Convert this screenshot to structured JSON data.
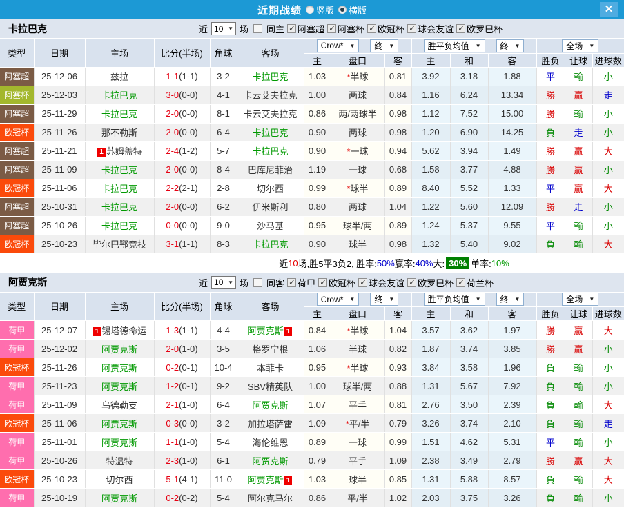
{
  "titlebar": {
    "title": "近期战绩",
    "radio_vertical": "竖版",
    "radio_horizontal": "横版",
    "radio_selected": "横版",
    "close": "✕"
  },
  "columns": {
    "type": "类型",
    "date": "日期",
    "home": "主场",
    "score": "比分(半场)",
    "corner": "角球",
    "away": "客场",
    "odds_home": "主",
    "odds_handicap": "盘口",
    "odds_away": "客",
    "avg_home": "主",
    "avg_draw": "和",
    "avg_away": "客",
    "result": "胜负",
    "handicap_result": "让球",
    "goals": "进球数"
  },
  "dropdowns": {
    "crow": "Crow*",
    "final": "终",
    "avg": "胜平负均值",
    "full": "全场"
  },
  "league_colors": {
    "阿塞超": "#7B5B45",
    "阿塞杯": "#A3B72D",
    "欧冠杯": "#FB4A0B",
    "荷甲": "#FF6EAE"
  },
  "outcome_colors": {
    "勝": "r",
    "平": "b",
    "負": "g",
    "贏": "r",
    "輸": "g",
    "走": "b",
    "大": "r",
    "小": "g"
  },
  "sections": [
    {
      "team": "卡拉巴克",
      "filter": {
        "near_label": "近",
        "games_value": "10",
        "games_label": "场",
        "same_label": "同主",
        "same_checked": false,
        "leagues": [
          "阿塞超",
          "阿塞杯",
          "欧冠杯",
          "球会友谊",
          "欧罗巴杯"
        ]
      },
      "rows": [
        {
          "lg": "阿塞超",
          "date": "25-12-06",
          "home": "兹拉",
          "hb": "",
          "hg": false,
          "ft": "1-1",
          "ht": "(1-1)",
          "cn": "3-2",
          "away": "卡拉巴克",
          "ab": "",
          "ag": true,
          "o1": "1.03",
          "star": true,
          "pk": "半球",
          "o2": "0.81",
          "m1": "3.92",
          "m2": "3.18",
          "m3": "1.88",
          "rs": "平",
          "hc": "輸",
          "gl": "小"
        },
        {
          "lg": "阿塞杯",
          "date": "25-12-03",
          "home": "卡拉巴克",
          "hb": "",
          "hg": true,
          "ft": "3-0",
          "ht": "(0-0)",
          "cn": "4-1",
          "away": "卡云艾夫拉克",
          "ab": "",
          "ag": false,
          "o1": "1.00",
          "star": false,
          "pk": "两球",
          "o2": "0.84",
          "m1": "1.16",
          "m2": "6.24",
          "m3": "13.34",
          "rs": "勝",
          "hc": "贏",
          "gl": "走"
        },
        {
          "lg": "阿塞超",
          "date": "25-11-29",
          "home": "卡拉巴克",
          "hb": "",
          "hg": true,
          "ft": "2-0",
          "ht": "(0-0)",
          "cn": "8-1",
          "away": "卡云艾夫拉克",
          "ab": "",
          "ag": false,
          "o1": "0.86",
          "star": false,
          "pk": "两/两球半",
          "o2": "0.98",
          "m1": "1.12",
          "m2": "7.52",
          "m3": "15.00",
          "rs": "勝",
          "hc": "輸",
          "gl": "小"
        },
        {
          "lg": "欧冠杯",
          "date": "25-11-26",
          "home": "那不勒斯",
          "hb": "",
          "hg": false,
          "ft": "2-0",
          "ht": "(0-0)",
          "cn": "6-4",
          "away": "卡拉巴克",
          "ab": "",
          "ag": true,
          "o1": "0.90",
          "star": false,
          "pk": "两球",
          "o2": "0.98",
          "m1": "1.20",
          "m2": "6.90",
          "m3": "14.25",
          "rs": "負",
          "hc": "走",
          "gl": "小"
        },
        {
          "lg": "阿塞超",
          "date": "25-11-21",
          "home": "苏姆盖特",
          "hb": "1",
          "hg": false,
          "ft": "2-4",
          "ht": "(1-2)",
          "cn": "5-7",
          "away": "卡拉巴克",
          "ab": "",
          "ag": true,
          "o1": "0.90",
          "star": true,
          "pk": "一球",
          "o2": "0.94",
          "m1": "5.62",
          "m2": "3.94",
          "m3": "1.49",
          "rs": "勝",
          "hc": "贏",
          "gl": "大"
        },
        {
          "lg": "阿塞超",
          "date": "25-11-09",
          "home": "卡拉巴克",
          "hb": "",
          "hg": true,
          "ft": "2-0",
          "ht": "(0-0)",
          "cn": "8-4",
          "away": "巴库尼菲治",
          "ab": "",
          "ag": false,
          "o1": "1.19",
          "star": false,
          "pk": "一球",
          "o2": "0.68",
          "m1": "1.58",
          "m2": "3.77",
          "m3": "4.88",
          "rs": "勝",
          "hc": "贏",
          "gl": "小"
        },
        {
          "lg": "欧冠杯",
          "date": "25-11-06",
          "home": "卡拉巴克",
          "hb": "",
          "hg": true,
          "ft": "2-2",
          "ht": "(2-1)",
          "cn": "2-8",
          "away": "切尔西",
          "ab": "",
          "ag": false,
          "o1": "0.99",
          "star": true,
          "pk": "球半",
          "o2": "0.89",
          "m1": "8.40",
          "m2": "5.52",
          "m3": "1.33",
          "rs": "平",
          "hc": "贏",
          "gl": "大"
        },
        {
          "lg": "阿塞超",
          "date": "25-10-31",
          "home": "卡拉巴克",
          "hb": "",
          "hg": true,
          "ft": "2-0",
          "ht": "(0-0)",
          "cn": "6-2",
          "away": "伊米斯利",
          "ab": "",
          "ag": false,
          "o1": "0.80",
          "star": false,
          "pk": "两球",
          "o2": "1.04",
          "m1": "1.22",
          "m2": "5.60",
          "m3": "12.09",
          "rs": "勝",
          "hc": "走",
          "gl": "小"
        },
        {
          "lg": "阿塞超",
          "date": "25-10-26",
          "home": "卡拉巴克",
          "hb": "",
          "hg": true,
          "ft": "0-0",
          "ht": "(0-0)",
          "cn": "9-0",
          "away": "沙马基",
          "ab": "",
          "ag": false,
          "o1": "0.95",
          "star": false,
          "pk": "球半/两",
          "o2": "0.89",
          "m1": "1.24",
          "m2": "5.37",
          "m3": "9.55",
          "rs": "平",
          "hc": "輸",
          "gl": "小"
        },
        {
          "lg": "欧冠杯",
          "date": "25-10-23",
          "home": "毕尔巴鄂竞技",
          "hb": "",
          "hg": false,
          "ft": "3-1",
          "ht": "(1-1)",
          "cn": "8-3",
          "away": "卡拉巴克",
          "ab": "",
          "ag": true,
          "o1": "0.90",
          "star": false,
          "pk": "球半",
          "o2": "0.98",
          "m1": "1.32",
          "m2": "5.40",
          "m3": "9.02",
          "rs": "負",
          "hc": "輸",
          "gl": "大"
        }
      ],
      "summary": [
        {
          "t": "近",
          "c": "k"
        },
        {
          "t": "10",
          "c": "r"
        },
        {
          "t": "场,胜5平3负2, 胜率:",
          "c": "k"
        },
        {
          "t": "50%",
          "c": "b"
        },
        {
          "t": " 赢率:",
          "c": "k"
        },
        {
          "t": "40%",
          "c": "b"
        },
        {
          "t": " 大: ",
          "c": "k"
        },
        {
          "t": "30%",
          "c": "wg"
        },
        {
          "t": " 单率:",
          "c": "k"
        },
        {
          "t": "10%",
          "c": "g"
        }
      ]
    },
    {
      "team": "阿贾克斯",
      "filter": {
        "near_label": "近",
        "games_value": "10",
        "games_label": "场",
        "same_label": "同客",
        "same_checked": false,
        "leagues": [
          "荷甲",
          "欧冠杯",
          "球会友谊",
          "欧罗巴杯",
          "荷兰杯"
        ]
      },
      "rows": [
        {
          "lg": "荷甲",
          "date": "25-12-07",
          "home": "锡塔德命运",
          "hb": "1",
          "hg": false,
          "ft": "1-3",
          "ht": "(1-1)",
          "cn": "4-4",
          "away": "阿贾克斯",
          "ab": "1",
          "ag": true,
          "o1": "0.84",
          "star": true,
          "pk": "半球",
          "o2": "1.04",
          "m1": "3.57",
          "m2": "3.62",
          "m3": "1.97",
          "rs": "勝",
          "hc": "贏",
          "gl": "大"
        },
        {
          "lg": "荷甲",
          "date": "25-12-02",
          "home": "阿贾克斯",
          "hb": "",
          "hg": true,
          "ft": "2-0",
          "ht": "(1-0)",
          "cn": "3-5",
          "away": "格罗宁根",
          "ab": "",
          "ag": false,
          "o1": "1.06",
          "star": false,
          "pk": "半球",
          "o2": "0.82",
          "m1": "1.87",
          "m2": "3.74",
          "m3": "3.85",
          "rs": "勝",
          "hc": "贏",
          "gl": "小"
        },
        {
          "lg": "欧冠杯",
          "date": "25-11-26",
          "home": "阿贾克斯",
          "hb": "",
          "hg": true,
          "ft": "0-2",
          "ht": "(0-1)",
          "cn": "10-4",
          "away": "本菲卡",
          "ab": "",
          "ag": false,
          "o1": "0.95",
          "star": true,
          "pk": "半球",
          "o2": "0.93",
          "m1": "3.84",
          "m2": "3.58",
          "m3": "1.96",
          "rs": "負",
          "hc": "輸",
          "gl": "小"
        },
        {
          "lg": "荷甲",
          "date": "25-11-23",
          "home": "阿贾克斯",
          "hb": "",
          "hg": true,
          "ft": "1-2",
          "ht": "(0-1)",
          "cn": "9-2",
          "away": "SBV精英队",
          "ab": "",
          "ag": false,
          "o1": "1.00",
          "star": false,
          "pk": "球半/两",
          "o2": "0.88",
          "m1": "1.31",
          "m2": "5.67",
          "m3": "7.92",
          "rs": "負",
          "hc": "輸",
          "gl": "小"
        },
        {
          "lg": "荷甲",
          "date": "25-11-09",
          "home": "乌德勒支",
          "hb": "",
          "hg": false,
          "ft": "2-1",
          "ht": "(1-0)",
          "cn": "6-4",
          "away": "阿贾克斯",
          "ab": "",
          "ag": true,
          "o1": "1.07",
          "star": false,
          "pk": "平手",
          "o2": "0.81",
          "m1": "2.76",
          "m2": "3.50",
          "m3": "2.39",
          "rs": "負",
          "hc": "輸",
          "gl": "大"
        },
        {
          "lg": "欧冠杯",
          "date": "25-11-06",
          "home": "阿贾克斯",
          "hb": "",
          "hg": true,
          "ft": "0-3",
          "ht": "(0-0)",
          "cn": "3-2",
          "away": "加拉塔萨雷",
          "ab": "",
          "ag": false,
          "o1": "1.09",
          "star": true,
          "pk": "平/半",
          "o2": "0.79",
          "m1": "3.26",
          "m2": "3.74",
          "m3": "2.10",
          "rs": "負",
          "hc": "輸",
          "gl": "走"
        },
        {
          "lg": "荷甲",
          "date": "25-11-01",
          "home": "阿贾克斯",
          "hb": "",
          "hg": true,
          "ft": "1-1",
          "ht": "(1-0)",
          "cn": "5-4",
          "away": "海伦维恩",
          "ab": "",
          "ag": false,
          "o1": "0.89",
          "star": false,
          "pk": "一球",
          "o2": "0.99",
          "m1": "1.51",
          "m2": "4.62",
          "m3": "5.31",
          "rs": "平",
          "hc": "輸",
          "gl": "小"
        },
        {
          "lg": "荷甲",
          "date": "25-10-26",
          "home": "特温特",
          "hb": "",
          "hg": false,
          "ft": "2-3",
          "ht": "(1-0)",
          "cn": "6-1",
          "away": "阿贾克斯",
          "ab": "",
          "ag": true,
          "o1": "0.79",
          "star": false,
          "pk": "平手",
          "o2": "1.09",
          "m1": "2.38",
          "m2": "3.49",
          "m3": "2.79",
          "rs": "勝",
          "hc": "贏",
          "gl": "大"
        },
        {
          "lg": "欧冠杯",
          "date": "25-10-23",
          "home": "切尔西",
          "hb": "",
          "hg": false,
          "ft": "5-1",
          "ht": "(4-1)",
          "cn": "11-0",
          "away": "阿贾克斯",
          "ab": "1",
          "ag": true,
          "o1": "1.03",
          "star": false,
          "pk": "球半",
          "o2": "0.85",
          "m1": "1.31",
          "m2": "5.88",
          "m3": "8.57",
          "rs": "負",
          "hc": "輸",
          "gl": "大"
        },
        {
          "lg": "荷甲",
          "date": "25-10-19",
          "home": "阿贾克斯",
          "hb": "",
          "hg": true,
          "ft": "0-2",
          "ht": "(0-2)",
          "cn": "5-4",
          "away": "阿尔克马尔",
          "ab": "",
          "ag": false,
          "o1": "0.86",
          "star": false,
          "pk": "平/半",
          "o2": "1.02",
          "m1": "2.03",
          "m2": "3.75",
          "m3": "3.26",
          "rs": "負",
          "hc": "輸",
          "gl": "小"
        }
      ],
      "summary": null
    }
  ]
}
